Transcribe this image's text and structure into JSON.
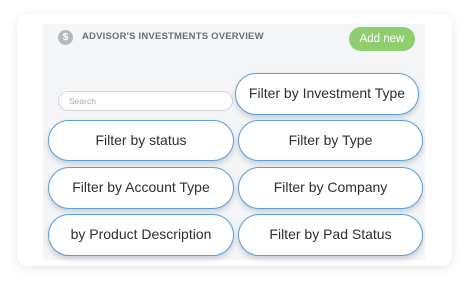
{
  "header": {
    "icon": "dollar-icon",
    "icon_glyph": "$",
    "title": "ADVISOR'S INVESTMENTS OVERVIEW",
    "add_label": "Add new"
  },
  "search": {
    "placeholder": "Search",
    "value": ""
  },
  "filters": {
    "investment_type": "Filter by Investment Type",
    "status": "Filter by status",
    "type": "Filter by Type",
    "account_type": "Filter by Account Type",
    "company": "Filter by Company",
    "product_description": "by Product Description",
    "pad_status": "Filter by Pad Status"
  },
  "colors": {
    "accent_green": "#8fcd6f",
    "pill_border": "#5b9fd6",
    "panel_bg": "#f5f6f8"
  }
}
